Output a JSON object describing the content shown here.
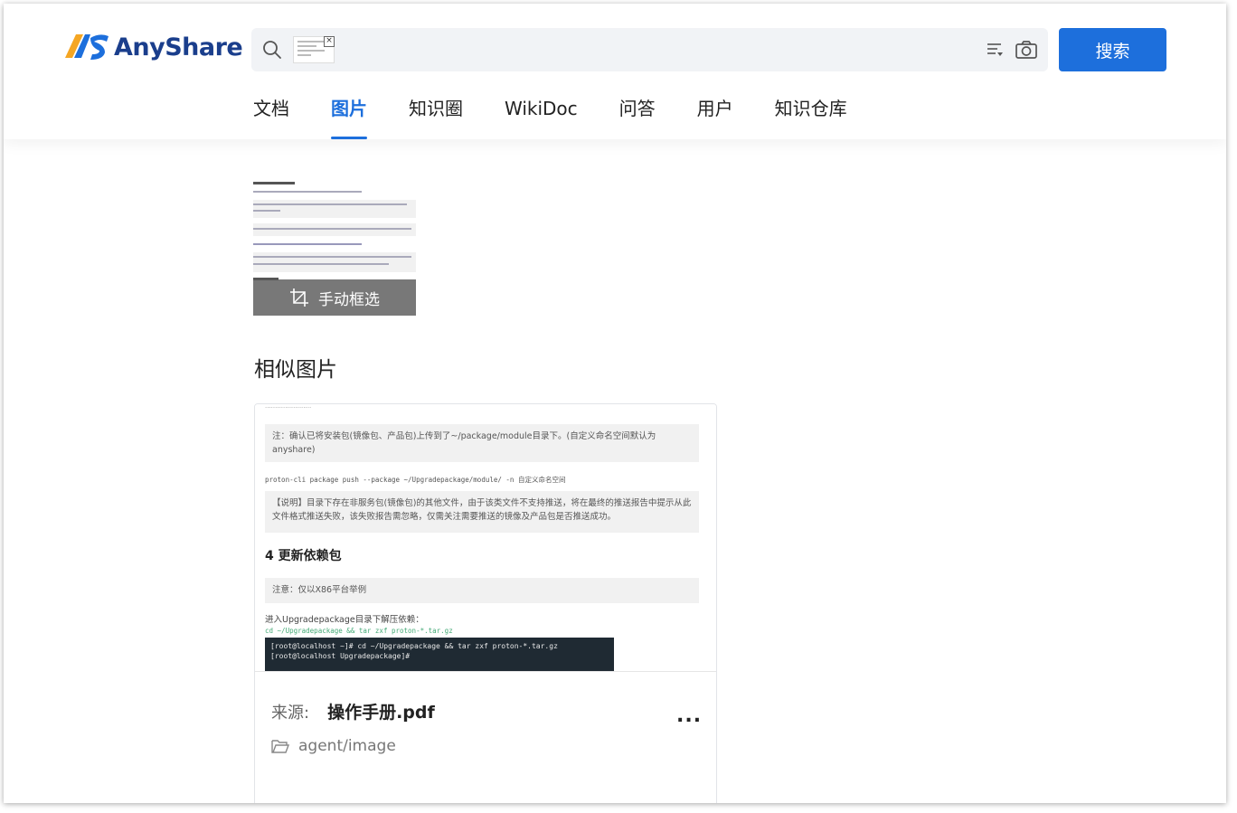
{
  "brand": {
    "name": "AnyShare",
    "logo_colors": [
      "#f5a623",
      "#1d6fdc"
    ]
  },
  "search": {
    "button_label": "搜索",
    "filter_icon": "filter-list-icon",
    "camera_icon": "camera-icon"
  },
  "tabs": [
    {
      "label": "文档",
      "active": false
    },
    {
      "label": "图片",
      "active": true
    },
    {
      "label": "知识圈",
      "active": false
    },
    {
      "label": "WikiDoc",
      "active": false
    },
    {
      "label": "问答",
      "active": false
    },
    {
      "label": "用户",
      "active": false
    },
    {
      "label": "知识仓库",
      "active": false
    }
  ],
  "query_image": {
    "overlay_label": "手动框选"
  },
  "similar": {
    "title": "相似图片"
  },
  "result": {
    "preview": {
      "note1": "注：确认已将安装包(镜像包、产品包)上传到了~/package/module目录下。(自定义命名空间默认为anyshare)",
      "code1": "proton-cli package push --package ~/Upgradepackage/module/ -n 自定义命名空间",
      "note2": "【说明】目录下存在非服务包(镜像包)的其他文件，由于该类文件不支持推送，将在最终的推送报告中提示从此文件格式推送失败，该失败报告需忽略，仅需关注需要推送的镜像及产品包是否推送成功。",
      "heading": "4 更新依赖包",
      "note3": "注意：仅以X86平台举例",
      "text1": "进入Upgradepackage目录下解压依赖：",
      "code2": "cd ~/Upgradepackage && tar zxf proton-*.tar.gz",
      "term1": "[root@localhost ~]# cd ~/Upgradepackage && tar zxf proton-*.tar.gz",
      "term2": "[root@localhost Upgradepackage]#"
    },
    "source_label": "来源:",
    "source_name": "操作手册.pdf",
    "path": "agent/image",
    "more_label": "..."
  }
}
